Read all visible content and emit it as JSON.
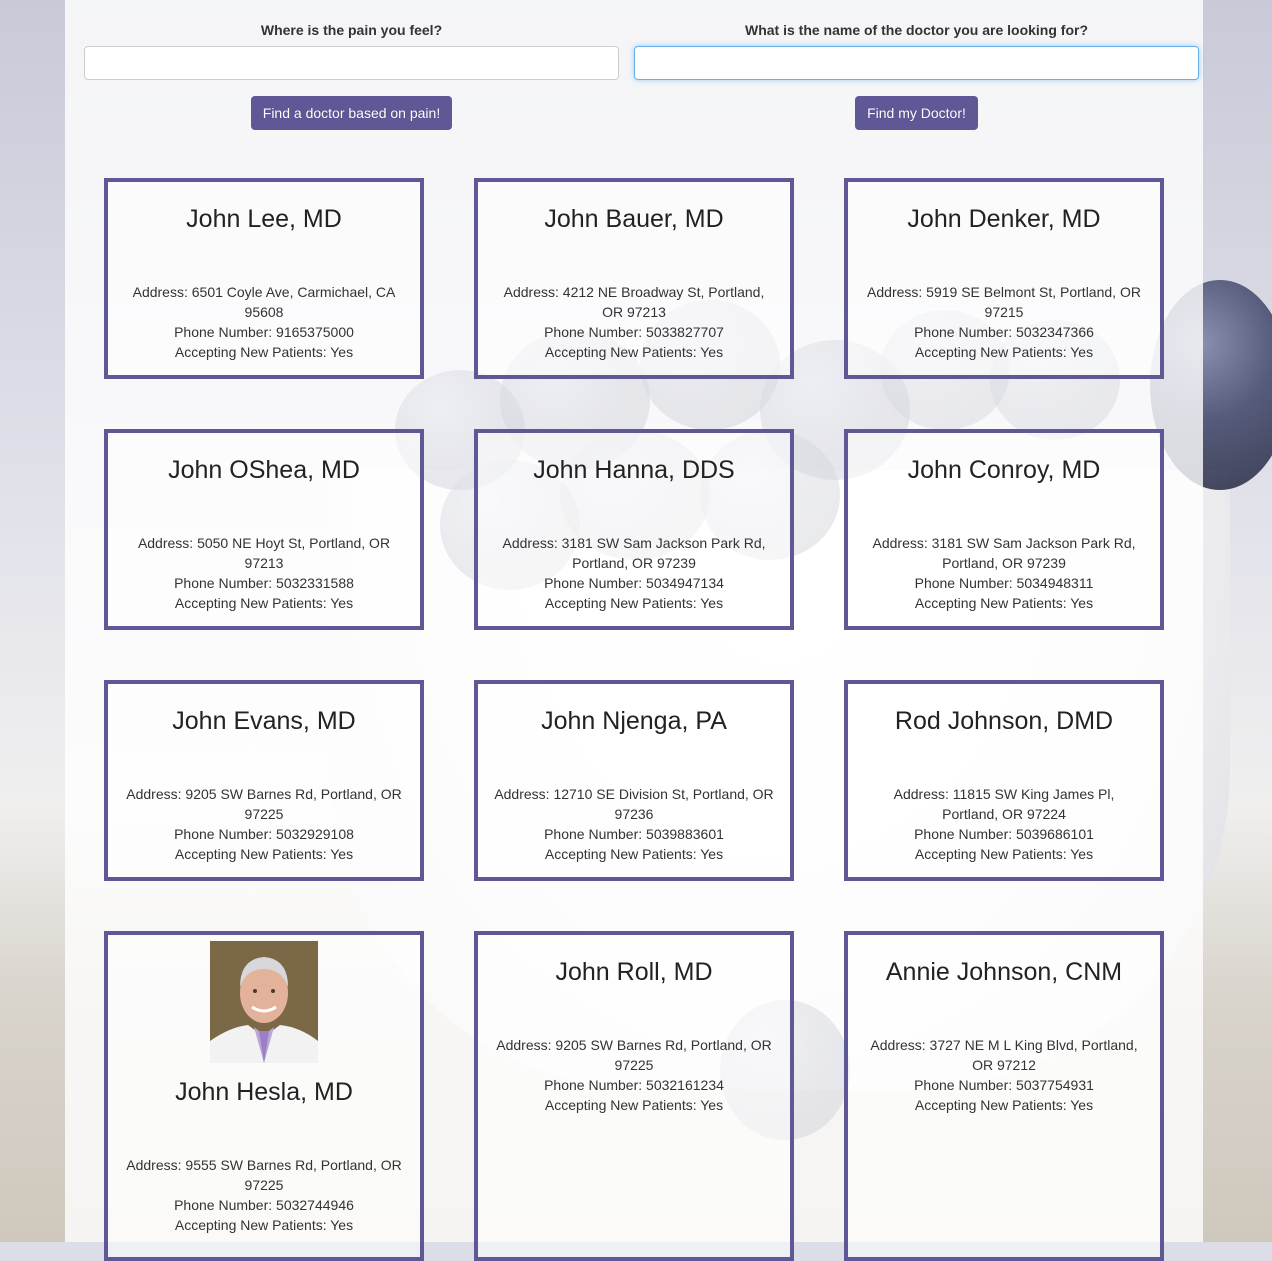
{
  "search": {
    "pain_label": "Where is the pain you feel?",
    "pain_value": "",
    "pain_button": "Find a doctor based on pain!",
    "doctor_label": "What is the name of the doctor you are looking for?",
    "doctor_value": "",
    "doctor_button": "Find my Doctor!"
  },
  "doctors": [
    {
      "name": "John Lee, MD",
      "address": "Address: 6501 Coyle Ave, Carmichael, CA 95608",
      "phone": "Phone Number: 9165375000",
      "accepting": "Accepting New Patients: Yes"
    },
    {
      "name": "John Bauer, MD",
      "address": "Address: 4212 NE Broadway St, Portland, OR 97213",
      "phone": "Phone Number: 5033827707",
      "accepting": "Accepting New Patients: Yes"
    },
    {
      "name": "John Denker, MD",
      "address": "Address: 5919 SE Belmont St, Portland, OR 97215",
      "phone": "Phone Number: 5032347366",
      "accepting": "Accepting New Patients: Yes"
    },
    {
      "name": "John OShea, MD",
      "address": "Address: 5050 NE Hoyt St, Portland, OR 97213",
      "phone": "Phone Number: 5032331588",
      "accepting": "Accepting New Patients: Yes"
    },
    {
      "name": "John Hanna, DDS",
      "address": "Address: 3181 SW Sam Jackson Park Rd, Portland, OR 97239",
      "phone": "Phone Number: 5034947134",
      "accepting": "Accepting New Patients: Yes"
    },
    {
      "name": "John Conroy, MD",
      "address": "Address: 3181 SW Sam Jackson Park Rd, Portland, OR 97239",
      "phone": "Phone Number: 5034948311",
      "accepting": "Accepting New Patients: Yes"
    },
    {
      "name": "John Evans, MD",
      "address": "Address: 9205 SW Barnes Rd, Portland, OR 97225",
      "phone": "Phone Number: 5032929108",
      "accepting": "Accepting New Patients: Yes"
    },
    {
      "name": "John Njenga, PA",
      "address": "Address: 12710 SE Division St, Portland, OR 97236",
      "phone": "Phone Number: 5039883601",
      "accepting": "Accepting New Patients: Yes"
    },
    {
      "name": "Rod Johnson, DMD",
      "address": "Address: 11815 SW King James Pl, Portland, OR 97224",
      "phone": "Phone Number: 5039686101",
      "accepting": "Accepting New Patients: Yes"
    },
    {
      "name": "John Hesla, MD",
      "address": "Address: 9555 SW Barnes Rd, Portland, OR 97225",
      "phone": "Phone Number: 5032744946",
      "accepting": "Accepting New Patients: Yes"
    },
    {
      "name": "John Roll, MD",
      "address": "Address: 9205 SW Barnes Rd, Portland, OR 97225",
      "phone": "Phone Number: 5032161234",
      "accepting": "Accepting New Patients: Yes"
    },
    {
      "name": "Annie Johnson, CNM",
      "address": "Address: 3727 NE M L King Blvd, Portland, OR 97212",
      "phone": "Phone Number: 5037754931",
      "accepting": "Accepting New Patients: Yes"
    }
  ],
  "theme": {
    "accent": "#5e5897"
  }
}
